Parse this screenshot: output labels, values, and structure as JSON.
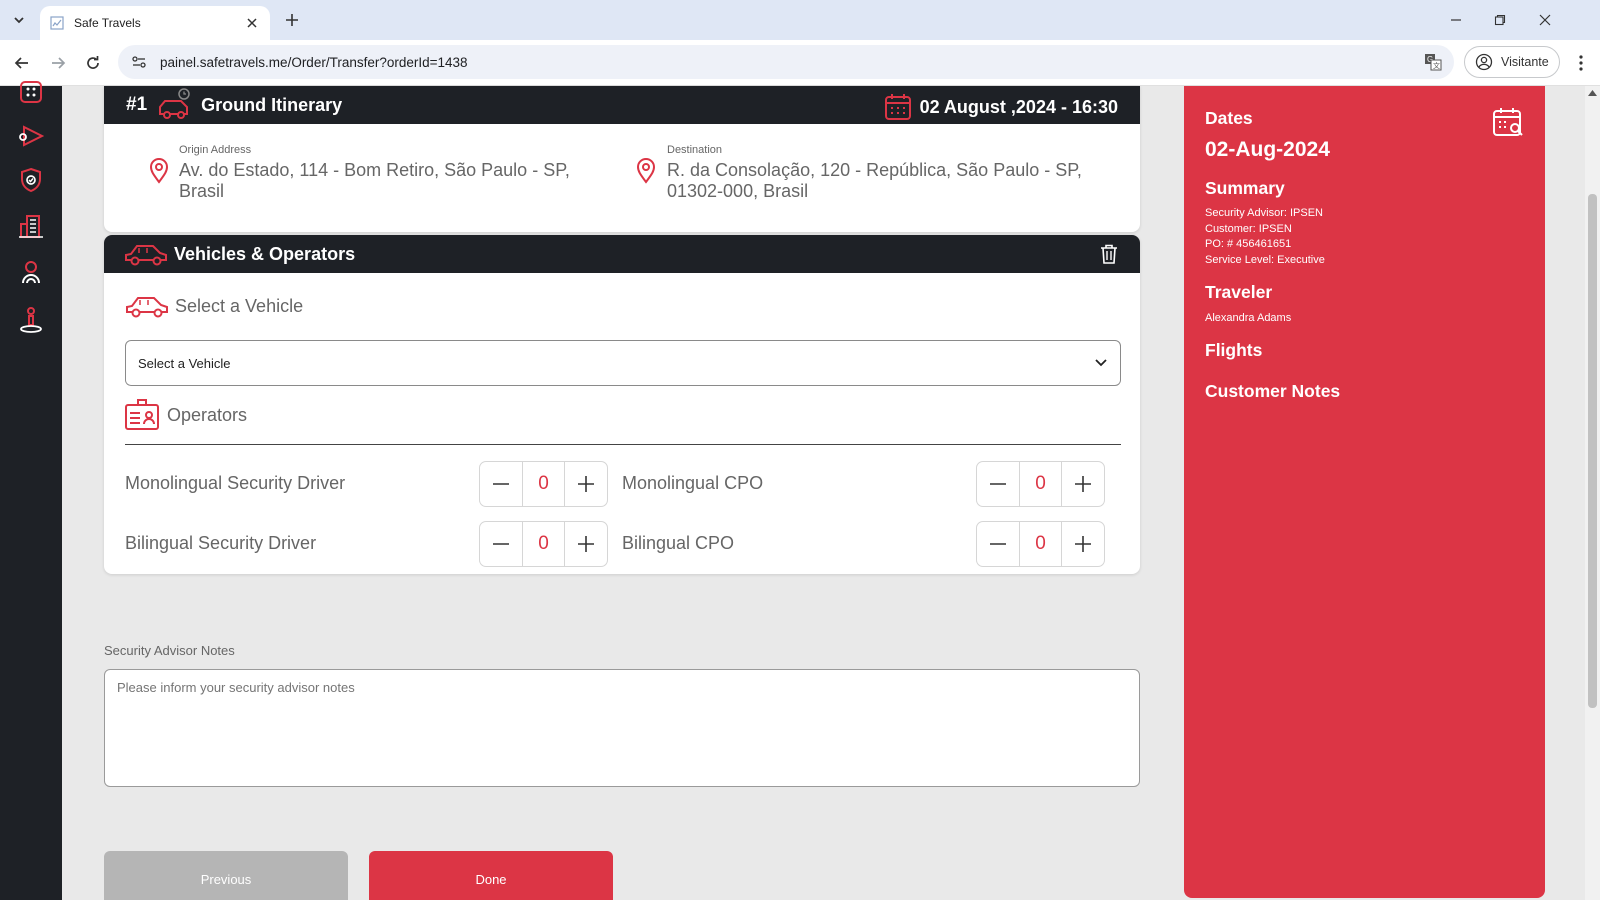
{
  "browser": {
    "tab_title": "Safe Travels",
    "url": "painel.safetravels.me/Order/Transfer?orderId=1438",
    "profile_label": "Visitante"
  },
  "itinerary": {
    "number": "#1",
    "title": "Ground Itinerary",
    "date": "02 August ,2024 - 16:30",
    "origin_label": "Origin Address",
    "origin_line1": "Av. do Estado, 114 - Bom Retiro, São Paulo - SP,",
    "origin_line2": "Brasil",
    "destination_label": "Destination",
    "destination_line1": "R. da Consolação, 120 - República, São Paulo - SP,",
    "destination_line2": "01302-000, Brasil"
  },
  "vehicles": {
    "title": "Vehicles & Operators",
    "select_heading": "Select a Vehicle",
    "select_value": "Select a Vehicle",
    "operators_heading": "Operators",
    "operators": [
      {
        "label": "Monolingual Security Driver",
        "value": "0"
      },
      {
        "label": "Monolingual CPO",
        "value": "0"
      },
      {
        "label": "Bilingual Security Driver",
        "value": "0"
      },
      {
        "label": "Bilingual CPO",
        "value": "0"
      }
    ]
  },
  "notes": {
    "label": "Security Advisor Notes",
    "placeholder": "Please inform your security advisor notes"
  },
  "buttons": {
    "previous": "Previous",
    "done": "Done"
  },
  "summary": {
    "dates_heading": "Dates",
    "date": "02-Aug-2024",
    "summary_heading": "Summary",
    "lines": [
      "Security Advisor: IPSEN",
      "Customer: IPSEN",
      "PO: # 456461651",
      "Service Level: Executive"
    ],
    "traveler_heading": "Traveler",
    "traveler": "Alexandra Adams",
    "flights_heading": "Flights",
    "notes_heading": "Customer Notes"
  },
  "colors": {
    "brand_red": "#dc3545",
    "dark": "#1e2126"
  }
}
